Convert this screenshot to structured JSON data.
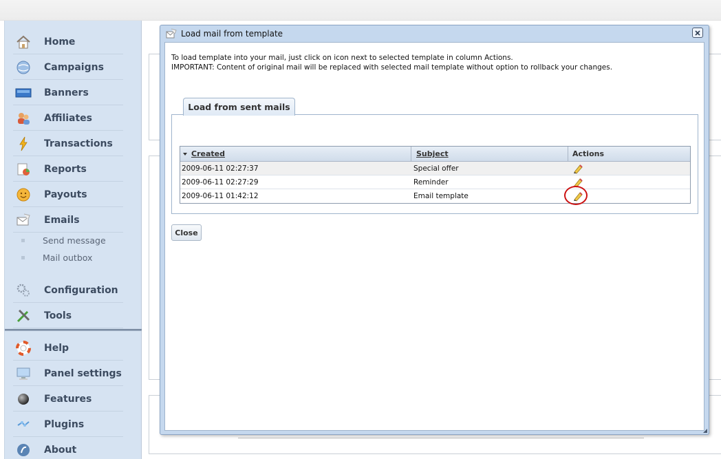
{
  "sidebar": {
    "items": [
      {
        "label": "Home",
        "icon": "home-icon"
      },
      {
        "label": "Campaigns",
        "icon": "globe-icon"
      },
      {
        "label": "Banners",
        "icon": "banner-icon"
      },
      {
        "label": "Affiliates",
        "icon": "users-icon"
      },
      {
        "label": "Transactions",
        "icon": "lightning-icon"
      },
      {
        "label": "Reports",
        "icon": "reports-icon"
      },
      {
        "label": "Payouts",
        "icon": "coin-icon"
      },
      {
        "label": "Emails",
        "icon": "envelope-icon"
      }
    ],
    "sub_items": [
      {
        "label": "Send message"
      },
      {
        "label": "Mail outbox"
      }
    ],
    "items2": [
      {
        "label": "Configuration",
        "icon": "gears-icon"
      },
      {
        "label": "Tools",
        "icon": "tools-icon"
      }
    ],
    "bottom_items": [
      {
        "label": "Help",
        "icon": "lifebuoy-icon"
      },
      {
        "label": "Panel settings",
        "icon": "monitor-icon"
      },
      {
        "label": "Features",
        "icon": "sphere-icon"
      },
      {
        "label": "Plugins",
        "icon": "plugin-icon"
      },
      {
        "label": "About",
        "icon": "about-icon"
      }
    ]
  },
  "dialog": {
    "title": "Load mail from template",
    "info_line1": "To load template into your mail, just click on icon next to selected template in column Actions.",
    "info_line2": "IMPORTANT: Content of original mail will be replaced with selected mail template without option to rollback your changes.",
    "tab_label": "Load from sent mails",
    "columns": {
      "created": "Created",
      "subject": "Subject",
      "actions": "Actions"
    },
    "rows": [
      {
        "created": "2009-06-11 02:27:37",
        "subject": "Special offer"
      },
      {
        "created": "2009-06-11 02:27:29",
        "subject": "Reminder"
      },
      {
        "created": "2009-06-11 01:42:12",
        "subject": "Email template"
      }
    ],
    "close_label": "Close"
  },
  "colors": {
    "sidebar_bg": "#d6e3f2",
    "dialog_frame": "#c5d8ee",
    "highlight": "#cc1111"
  }
}
